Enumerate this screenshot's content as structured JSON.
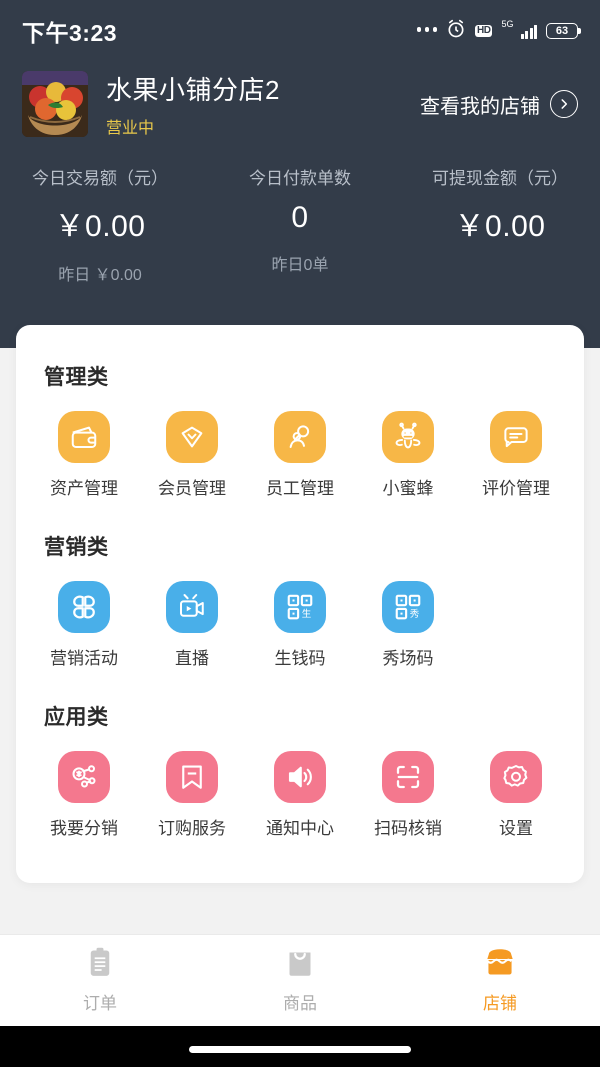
{
  "statusbar": {
    "time": "下午3:23",
    "battery_percent": "63",
    "network_label": "5G",
    "hd_label": "HD",
    "icons": [
      "more-dots-icon",
      "alarm-clock-icon",
      "hd-icon",
      "signal-5g-icon",
      "battery-icon"
    ]
  },
  "header": {
    "avatar_name": "fruit-basket-avatar",
    "shop_name": "水果小铺分店2",
    "shop_status": "营业中",
    "status_color": "#e8c84a",
    "view_shop_label": "查看我的店铺"
  },
  "stats": [
    {
      "label": "今日交易额（元）",
      "value": "￥0.00",
      "sub": "昨日 ￥0.00"
    },
    {
      "label": "今日付款单数",
      "value": "0",
      "sub": "昨日0单"
    },
    {
      "label": "可提现金额（元）",
      "value": "￥0.00",
      "sub": ""
    }
  ],
  "sections": [
    {
      "title": "管理类",
      "color": "#f7b747",
      "color_class": "orange",
      "items": [
        {
          "label": "资产管理",
          "icon": "wallet-icon"
        },
        {
          "label": "会员管理",
          "icon": "diamond-member-icon"
        },
        {
          "label": "员工管理",
          "icon": "staff-search-icon"
        },
        {
          "label": "小蜜蜂",
          "icon": "bee-icon"
        },
        {
          "label": "评价管理",
          "icon": "chat-bubble-icon"
        }
      ]
    },
    {
      "title": "营销类",
      "color": "#49afe9",
      "color_class": "blue",
      "items": [
        {
          "label": "营销活动",
          "icon": "clover-icon"
        },
        {
          "label": "直播",
          "icon": "video-camera-icon"
        },
        {
          "label": "生钱码",
          "icon": "qr-code-sheng-icon",
          "glyph": "生"
        },
        {
          "label": "秀场码",
          "icon": "qr-code-xiu-icon",
          "glyph": "秀"
        }
      ]
    },
    {
      "title": "应用类",
      "color": "#f4788e",
      "color_class": "pink",
      "items": [
        {
          "label": "我要分销",
          "icon": "share-node-icon"
        },
        {
          "label": "订购服务",
          "icon": "bookmark-icon"
        },
        {
          "label": "通知中心",
          "icon": "speaker-icon"
        },
        {
          "label": "扫码核销",
          "icon": "scan-frame-icon"
        },
        {
          "label": "设置",
          "icon": "gear-icon"
        }
      ]
    }
  ],
  "tabbar": {
    "active_color": "#f59a23",
    "inactive_color": "#adadad",
    "items": [
      {
        "label": "订单",
        "icon": "clipboard-icon",
        "active": false
      },
      {
        "label": "商品",
        "icon": "shopping-bag-icon",
        "active": false
      },
      {
        "label": "店铺",
        "icon": "storefront-icon",
        "active": true
      }
    ]
  }
}
